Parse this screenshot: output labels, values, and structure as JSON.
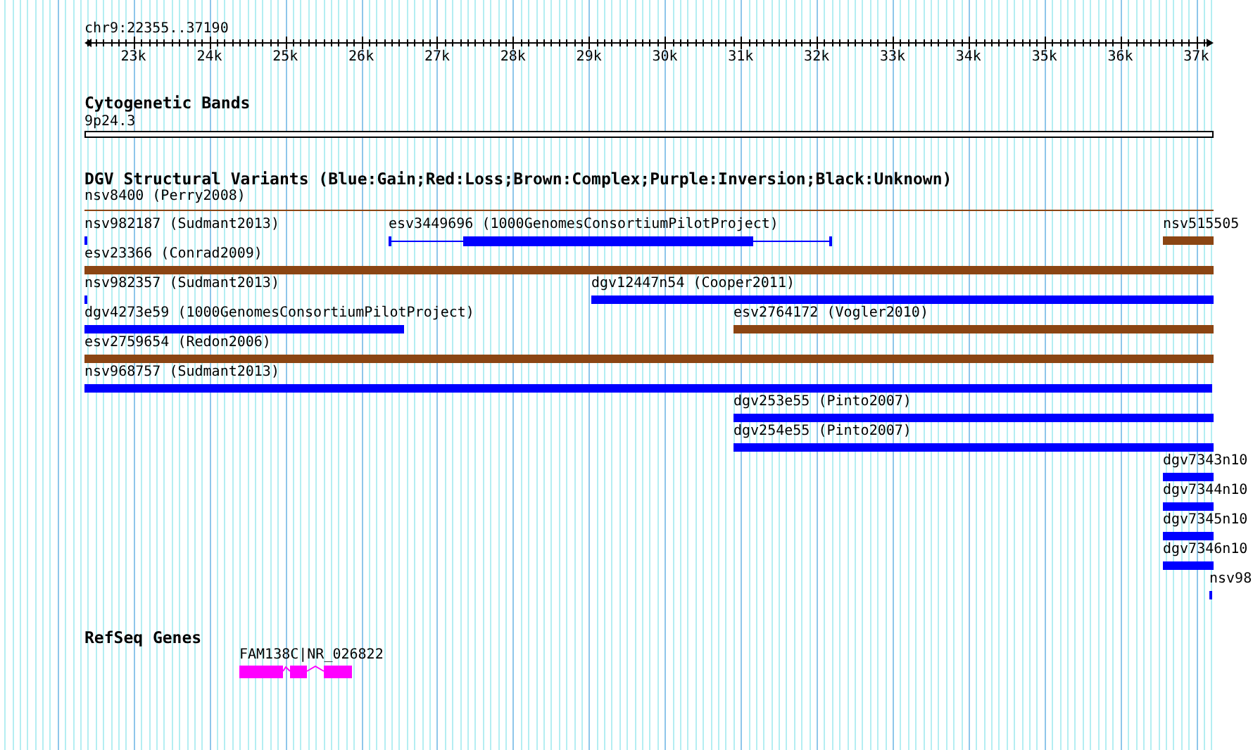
{
  "ruler": {
    "location": "chr9:22355..37190",
    "tick_labels": [
      "23k",
      "24k",
      "25k",
      "26k",
      "27k",
      "28k",
      "29k",
      "30k",
      "31k",
      "32k",
      "33k",
      "34k",
      "35k",
      "36k",
      "37k"
    ]
  },
  "cytogenetic_bands": {
    "title": "Cytogenetic Bands",
    "bands": [
      {
        "label": "9p24.3"
      }
    ]
  },
  "dgv": {
    "title": "DGV Structural Variants (Blue:Gain;Red:Loss;Brown:Complex;Purple:Inversion;Black:Unknown)",
    "features": [
      {
        "label": "nsv8400 (Perry2008)",
        "color": "#8b4513",
        "kind": "line"
      },
      {
        "label": "nsv982187 (Sudmant2013)",
        "color": "#0000ff",
        "kind": "bar"
      },
      {
        "label": "esv3449696 (1000GenomesConsortiumPilotProject)",
        "color": "#0000ff",
        "kind": "gapped"
      },
      {
        "label": "nsv515505",
        "color": "#8b4513",
        "kind": "bar"
      },
      {
        "label": "esv23366 (Conrad2009)",
        "color": "#8b4513",
        "kind": "bar"
      },
      {
        "label": "nsv982357 (Sudmant2013)",
        "color": "#0000ff",
        "kind": "bar"
      },
      {
        "label": "dgv12447n54 (Cooper2011)",
        "color": "#0000ff",
        "kind": "bar"
      },
      {
        "label": "dgv4273e59 (1000GenomesConsortiumPilotProject)",
        "color": "#0000ff",
        "kind": "bar"
      },
      {
        "label": "esv2764172 (Vogler2010)",
        "color": "#8b4513",
        "kind": "bar"
      },
      {
        "label": "esv2759654 (Redon2006)",
        "color": "#8b4513",
        "kind": "bar"
      },
      {
        "label": "nsv968757 (Sudmant2013)",
        "color": "#0000ff",
        "kind": "bar"
      },
      {
        "label": "dgv253e55 (Pinto2007)",
        "color": "#0000ff",
        "kind": "bar"
      },
      {
        "label": "dgv254e55 (Pinto2007)",
        "color": "#0000ff",
        "kind": "bar"
      },
      {
        "label": "dgv7343n10",
        "color": "#0000ff",
        "kind": "bar"
      },
      {
        "label": "dgv7344n10",
        "color": "#0000ff",
        "kind": "bar"
      },
      {
        "label": "dgv7345n10",
        "color": "#0000ff",
        "kind": "bar"
      },
      {
        "label": "dgv7346n10",
        "color": "#0000ff",
        "kind": "bar"
      },
      {
        "label": "nsv98",
        "color": "#0000ff",
        "kind": "bar"
      }
    ]
  },
  "refseq_genes": {
    "title": "RefSeq Genes",
    "genes": [
      {
        "label": "FAM138C|NR_026822"
      }
    ]
  }
}
